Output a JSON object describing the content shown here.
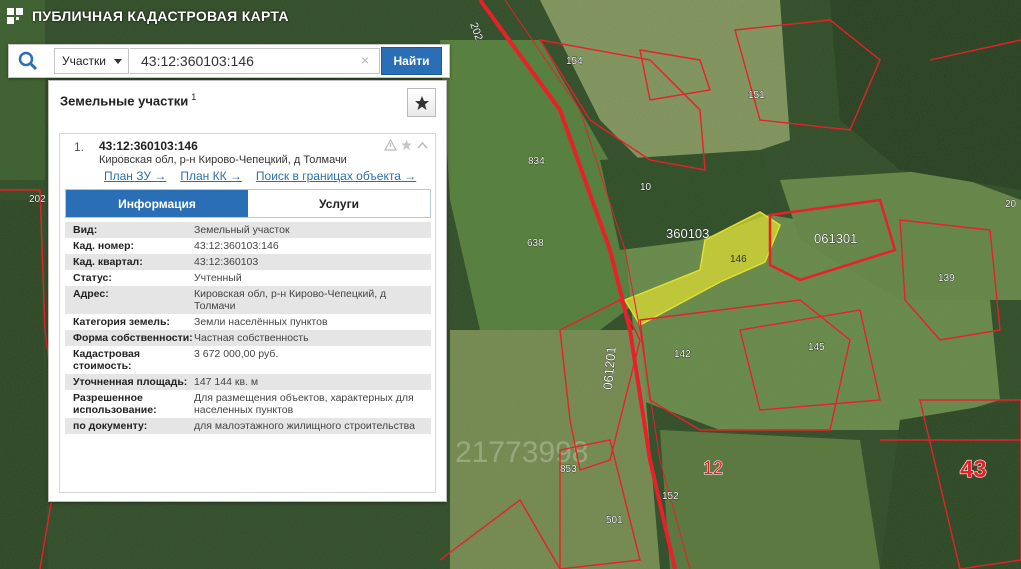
{
  "app": {
    "title": "ПУБЛИЧНАЯ КАДАСТРОВАЯ КАРТА"
  },
  "search": {
    "type_label": "Участки",
    "query": "43:12:360103:146",
    "find_label": "Найти",
    "clear_glyph": "×"
  },
  "panel": {
    "title": "Земельные участки",
    "title_count": "1",
    "result": {
      "index": "1.",
      "cadastral": "43:12:360103:146",
      "location": "Кировская обл, р-н Кирово-Чепецкий, д Толмачи",
      "links": [
        "План ЗУ →",
        "План КК →",
        "Поиск в границах объекта →"
      ],
      "tabs": [
        {
          "label": "Информация"
        },
        {
          "label": "Услуги"
        }
      ],
      "fields": [
        {
          "k": "Вид:",
          "v": "Земельный участок"
        },
        {
          "k": "Кад. номер:",
          "v": "43:12:360103:146"
        },
        {
          "k": "Кад. квартал:",
          "v": "43:12:360103"
        },
        {
          "k": "Статус:",
          "v": "Учтенный"
        },
        {
          "k": "Адрес:",
          "v": "Кировская обл, р-н Кирово-Чепецкий, д Толмачи"
        },
        {
          "k": "Категория земель:",
          "v": "Земли населённых пунктов"
        },
        {
          "k": "Форма собственности:",
          "v": "Частная собственность"
        },
        {
          "k": "Кадастровая стоимость:",
          "v": "3 672 000,00 руб."
        },
        {
          "k": "Уточненная площадь:",
          "v": "147 144 кв. м"
        },
        {
          "k": "Разрешенное использование:",
          "v": "Для размещения объектов, характерных для населенных пунктов"
        },
        {
          "k": "по документу:",
          "v": "для малоэтажного жилищного строительства"
        }
      ]
    }
  },
  "map": {
    "labels": {
      "q360103": "360103",
      "q061301": "061301",
      "q061201": "061201",
      "d12": "12",
      "d43": "43",
      "road": "202",
      "sel": "146",
      "p154": "154",
      "p151": "151",
      "p834": "834",
      "p10": "10",
      "p638": "638",
      "p139": "139",
      "p142": "142",
      "p145": "145",
      "p853": "853",
      "p152": "152",
      "p501": "501",
      "p202w": "202",
      "p20e": "20"
    },
    "watermark": "21773998",
    "colors": {
      "boundary": "#e8202a",
      "selected": "#e3e030"
    }
  }
}
